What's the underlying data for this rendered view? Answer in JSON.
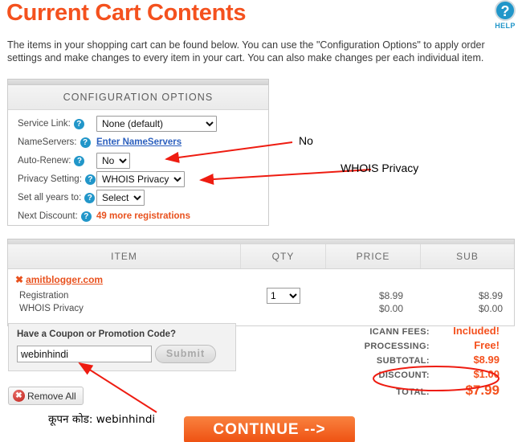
{
  "header": {
    "title": "Current Cart Contents",
    "help_icon": "question-mark-icon",
    "help_label": "HELP",
    "intro": "The items in your shopping cart can be found below. You can use the \"Configuration Options\" to apply order settings and make changes to every item in your cart. You can also make changes per each individual item."
  },
  "config": {
    "heading": "CONFIGURATION OPTIONS",
    "rows": [
      {
        "label": "Service Link:",
        "type": "select",
        "value": "None (default)"
      },
      {
        "label": "NameServers:",
        "type": "link",
        "value": "Enter NameServers"
      },
      {
        "label": "Auto-Renew:",
        "type": "select",
        "value": "No"
      },
      {
        "label": "Privacy Setting:",
        "type": "select",
        "value": "WHOIS Privacy"
      },
      {
        "label": "Set all years to:",
        "type": "select",
        "value": "Select"
      },
      {
        "label": "Next Discount:",
        "type": "text",
        "value": "49 more registrations"
      }
    ]
  },
  "table": {
    "columns": [
      "ITEM",
      "QTY",
      "PRICE",
      "SUB"
    ],
    "item": {
      "domain": "amitblogger.com",
      "remove_icon": "x-remove-icon",
      "lines": [
        {
          "label": "Registration",
          "qty": "1",
          "price": "$8.99",
          "sub": "$8.99"
        },
        {
          "label": "WHOIS Privacy",
          "qty": "",
          "price": "$0.00",
          "sub": "$0.00"
        }
      ]
    }
  },
  "coupon": {
    "title": "Have a Coupon or Promotion Code?",
    "value": "webinhindi",
    "placeholder": "",
    "submit_label": "Submit"
  },
  "remove_all": {
    "label": "Remove All",
    "icon": "remove-circle-icon"
  },
  "totals": [
    {
      "label": "ICANN FEES:",
      "value": "Included!"
    },
    {
      "label": "PROCESSING:",
      "value": "Free!"
    },
    {
      "label": "SUBTOTAL:",
      "value": "$8.99"
    },
    {
      "label": "DISCOUNT:",
      "value": "$1.00"
    },
    {
      "label": "TOTAL:",
      "value": "$7.99"
    }
  ],
  "continue": {
    "label": "CONTINUE -->"
  },
  "annotations": {
    "auto_renew": "No",
    "privacy": "WHOIS Privacy",
    "coupon_hindi": "कूपन कोड: webinhindi",
    "highlight_color": "#ee1c11"
  }
}
